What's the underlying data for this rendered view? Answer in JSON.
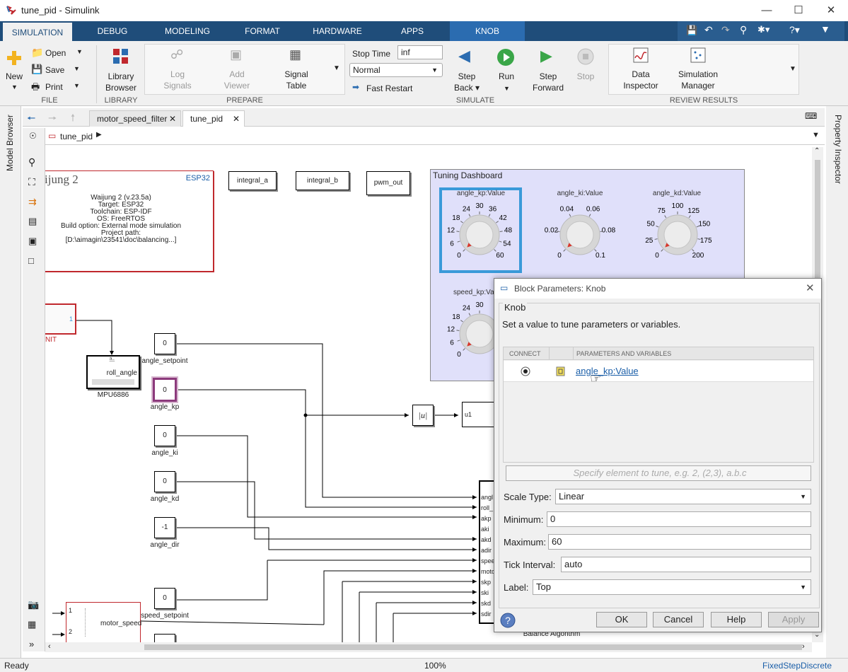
{
  "window": {
    "title": "tune_pid - Simulink"
  },
  "tabs": [
    "SIMULATION",
    "DEBUG",
    "MODELING",
    "FORMAT",
    "HARDWARE",
    "APPS",
    "KNOB"
  ],
  "ribbon": {
    "file": {
      "new": "New",
      "open": "Open",
      "save": "Save",
      "print": "Print",
      "label": "FILE"
    },
    "library": {
      "browser_line1": "Library",
      "browser_line2": "Browser",
      "label": "LIBRARY"
    },
    "prepare": {
      "log1": "Log",
      "log2": "Signals",
      "add1": "Add",
      "add2": "Viewer",
      "sig1": "Signal",
      "sig2": "Table",
      "label": "PREPARE"
    },
    "simulate": {
      "stop_time_label": "Stop Time",
      "stop_time_value": "inf",
      "mode": "Normal",
      "fast_restart": "Fast Restart",
      "step_back1": "Step",
      "step_back2": "Back",
      "run": "Run",
      "step_fwd1": "Step",
      "step_fwd2": "Forward",
      "stop": "Stop",
      "label": "SIMULATE"
    },
    "review": {
      "di1": "Data",
      "di2": "Inspector",
      "sm1": "Simulation",
      "sm2": "Manager",
      "label": "REVIEW RESULTS"
    }
  },
  "doc_tabs": [
    "motor_speed_filter",
    "tune_pid"
  ],
  "breadcrumb": "tune_pid",
  "side_left": "Model Browser",
  "side_right": "Property Inspector",
  "waijung": {
    "title": "ijung 2",
    "target_badge": "ESP32",
    "lines": [
      "Waijung 2 (v.23.5a)",
      "Target: ESP32",
      "Toolchain: ESP-IDF",
      "OS: FreeRTOS",
      "Build option: External mode simulation",
      "Project path:",
      "[D:\\aimagin\\23541\\doc\\balancing...]"
    ]
  },
  "top_blocks": [
    "integral_a",
    "integral_b",
    "pwm_out"
  ],
  "dashboard": {
    "title": "Tuning Dashboard",
    "knobs": [
      {
        "label": "angle_kp:Value",
        "ticks": [
          "0",
          "6",
          "12",
          "18",
          "24",
          "30",
          "36",
          "42",
          "48",
          "54",
          "60"
        ],
        "value": 0
      },
      {
        "label": "angle_ki:Value",
        "ticks": [
          "0",
          "0.02",
          "0.04",
          "0.06",
          "0.08",
          "0.1"
        ],
        "value": 0
      },
      {
        "label": "angle_kd:Value",
        "ticks": [
          "0",
          "25",
          "50",
          "75",
          "100",
          "125",
          "150",
          "175",
          "200"
        ],
        "value": 0
      },
      {
        "label": "speed_kp:Va",
        "ticks": [
          "0",
          "6",
          "12",
          "18",
          "24",
          "30"
        ],
        "value": 0
      }
    ]
  },
  "blocks": {
    "init_port": "1",
    "init_label": "NIT",
    "mpu_out": "roll_angle",
    "mpu_name": "MPU6886",
    "consts": [
      {
        "value": "0",
        "name": "angle_setpoint"
      },
      {
        "value": "0",
        "name": "angle_kp"
      },
      {
        "value": "0",
        "name": "angle_ki"
      },
      {
        "value": "0",
        "name": "angle_kd"
      },
      {
        "value": "-1",
        "name": "angle_dir"
      },
      {
        "value": "0",
        "name": "speed_setpoint"
      }
    ],
    "abs_label": "|u|",
    "u1": "u1",
    "motor_speed": "motor_speed",
    "port1": "1",
    "port2": "2",
    "balance_ports": [
      "angl",
      "roll_",
      "akp",
      "aki",
      "akd",
      "adir",
      "spee",
      "moto",
      "skp",
      "ski",
      "skd",
      "sdir"
    ],
    "balance_name": "Balance Algorithm"
  },
  "dialog": {
    "title": "Block Parameters: Knob",
    "group": "Knob",
    "description": "Set a value to tune parameters or variables.",
    "col_connect": "CONNECT",
    "col_params": "PARAMETERS AND VARIABLES",
    "row_param": "angle_kp:Value",
    "element_placeholder": "Specify element to tune, e.g. 2, (2,3), a.b.c",
    "scale_type_label": "Scale Type:",
    "scale_type_value": "Linear",
    "minimum_label": "Minimum:",
    "minimum_value": "0",
    "maximum_label": "Maximum:",
    "maximum_value": "60",
    "tick_label": "Tick Interval:",
    "tick_value": "auto",
    "label_label": "Label:",
    "label_value": "Top",
    "ok": "OK",
    "cancel": "Cancel",
    "help": "Help",
    "apply": "Apply"
  },
  "status": {
    "left": "Ready",
    "zoom": "100%",
    "solver": "FixedStepDiscrete"
  },
  "colors": {
    "accent": "#1f4d7a",
    "highlight": "#3a9ad9",
    "link": "#1a5ea8",
    "block_red": "#c0282d"
  }
}
